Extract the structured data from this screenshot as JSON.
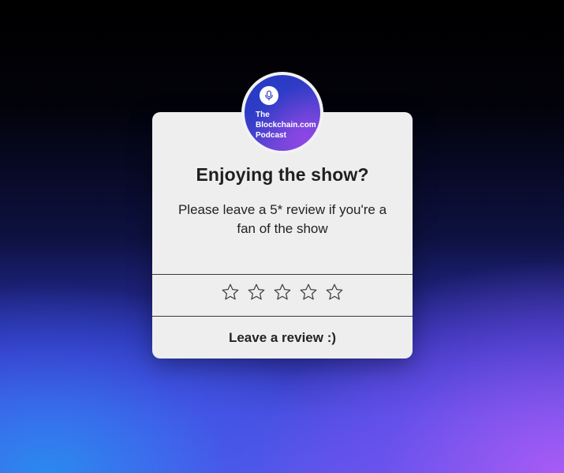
{
  "podcast": {
    "logo_line1": "The",
    "logo_line2": "Blockchain.com",
    "logo_line3": "Podcast",
    "mic_icon": "microphone-icon"
  },
  "dialog": {
    "title": "Enjoying the show?",
    "message": "Please leave a 5* review if you're a fan of the show",
    "rating": {
      "max": 5,
      "selected": 0,
      "icon": "star-outline-icon"
    },
    "button_label": "Leave a review :)"
  },
  "colors": {
    "card_background": "#eeeeef",
    "text_primary": "#1f1f22",
    "divider": "#3a3a3e",
    "background_top": "#000000",
    "background_bottom_left": "#288cf0",
    "background_bottom_right": "#ad5cf5"
  }
}
